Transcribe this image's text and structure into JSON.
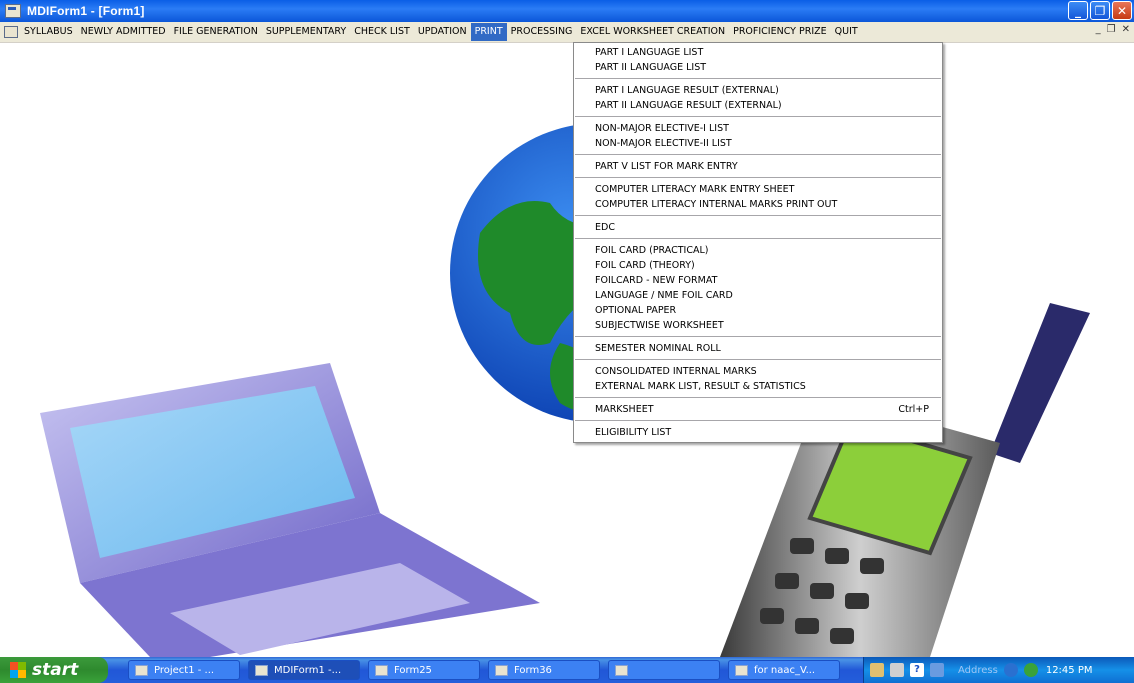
{
  "window": {
    "title": "MDIForm1 - [Form1]"
  },
  "menubar": {
    "items": [
      "SYLLABUS",
      "NEWLY ADMITTED",
      "FILE GENERATION",
      "SUPPLEMENTARY",
      "CHECK LIST",
      "UPDATION",
      "PRINT",
      "PROCESSING",
      "EXCEL WORKSHEET CREATION",
      "PROFICIENCY PRIZE",
      "QUIT"
    ],
    "active": "PRINT"
  },
  "print_menu": {
    "groups": [
      [
        "PART I LANGUAGE LIST",
        "PART II LANGUAGE LIST"
      ],
      [
        "PART I LANGUAGE RESULT (EXTERNAL)",
        "PART II LANGUAGE RESULT (EXTERNAL)"
      ],
      [
        "NON-MAJOR ELECTIVE-I LIST",
        "NON-MAJOR ELECTIVE-II LIST"
      ],
      [
        "PART V LIST FOR MARK ENTRY"
      ],
      [
        "COMPUTER LITERACY MARK ENTRY SHEET",
        "COMPUTER LITERACY INTERNAL MARKS PRINT OUT"
      ],
      [
        "EDC"
      ],
      [
        "FOIL CARD (PRACTICAL)",
        "FOIL CARD (THEORY)",
        "FOILCARD - NEW FORMAT",
        "LANGUAGE / NME  FOIL CARD",
        "OPTIONAL PAPER",
        "SUBJECTWISE WORKSHEET"
      ],
      [
        "SEMESTER NOMINAL ROLL"
      ],
      [
        "CONSOLIDATED INTERNAL MARKS",
        "EXTERNAL MARK LIST, RESULT & STATISTICS"
      ],
      [
        "MARKSHEET"
      ],
      [
        "ELIGIBILITY LIST"
      ]
    ],
    "marksheet_shortcut": "Ctrl+P"
  },
  "taskbar": {
    "start_label": "start",
    "tasks": [
      {
        "label": "Project1 - ...",
        "active": false
      },
      {
        "label": "MDIForm1 -...",
        "active": true
      },
      {
        "label": "Form25",
        "active": false
      },
      {
        "label": "Form36",
        "active": false
      },
      {
        "label": "",
        "active": false
      },
      {
        "label": "for naac_V...",
        "active": false
      }
    ],
    "address_label": "Address",
    "clock": "12:45 PM"
  }
}
